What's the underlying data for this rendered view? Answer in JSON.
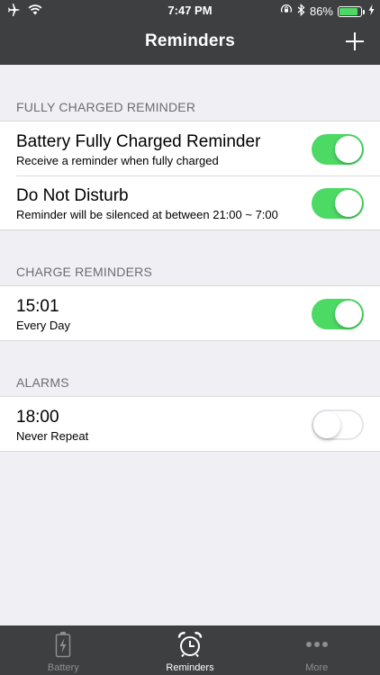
{
  "status_bar": {
    "time": "7:47 PM",
    "battery_percent": "86%",
    "battery_level": 0.86,
    "icons": [
      "airplane-icon",
      "wifi-icon",
      "orientation-lock-icon",
      "bluetooth-icon",
      "battery-icon",
      "charging-bolt-icon"
    ]
  },
  "nav": {
    "title": "Reminders",
    "add_icon": "plus-icon"
  },
  "sections": {
    "fully_charged": {
      "header": "FULLY CHARGED REMINDER",
      "rows": [
        {
          "title": "Battery Fully Charged Reminder",
          "subtitle": "Receive a reminder when fully charged",
          "enabled": true
        },
        {
          "title": "Do Not Disturb",
          "subtitle": "Reminder will be silenced at between 21:00 ~ 7:00",
          "enabled": true
        }
      ]
    },
    "charge_reminders": {
      "header": "CHARGE REMINDERS",
      "rows": [
        {
          "title": "15:01",
          "subtitle": "Every Day",
          "enabled": true
        }
      ]
    },
    "alarms": {
      "header": "ALARMS",
      "rows": [
        {
          "title": "18:00",
          "subtitle": "Never Repeat",
          "enabled": false
        }
      ]
    }
  },
  "tabbar": {
    "tabs": [
      {
        "label": "Battery",
        "icon": "battery-tab-icon",
        "active": false
      },
      {
        "label": "Reminders",
        "icon": "alarm-clock-icon",
        "active": true
      },
      {
        "label": "More",
        "icon": "more-dots-icon",
        "active": false
      }
    ]
  },
  "colors": {
    "bar_background": "#3e3f41",
    "page_background": "#efeff4",
    "toggle_on": "#4cd964",
    "section_header_text": "#6d6d72"
  }
}
